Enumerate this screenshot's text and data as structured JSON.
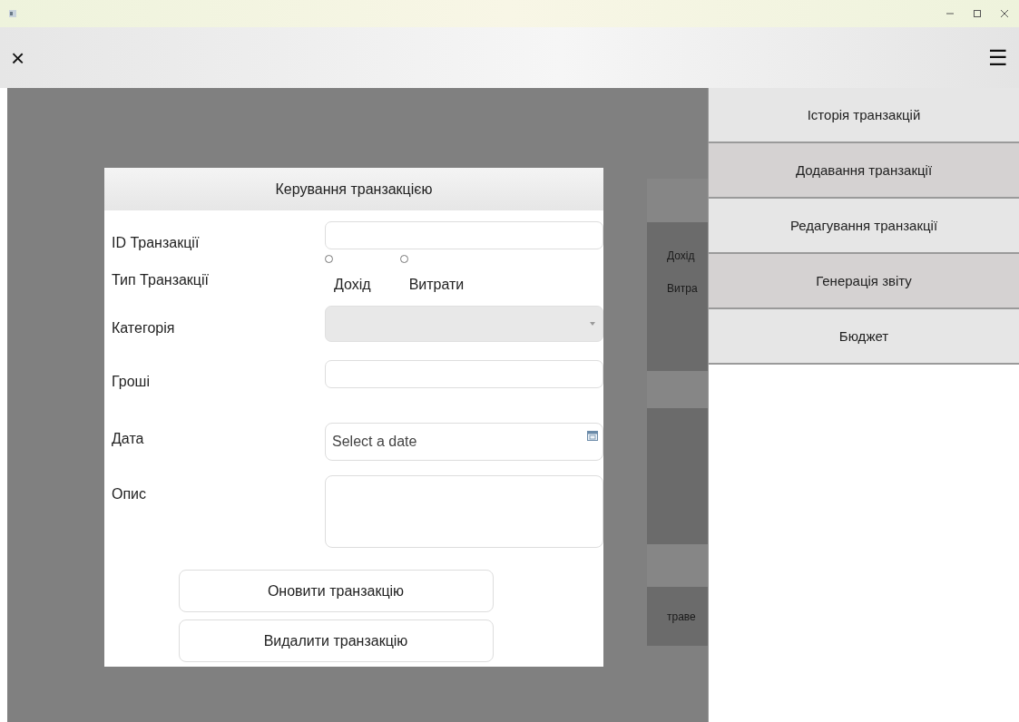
{
  "header": {
    "close_icon": "×",
    "menu_icon": "☰"
  },
  "background": {
    "cards": [
      {
        "kind": "panel",
        "lines": [
          "Дохід",
          "Витра"
        ]
      },
      {
        "kind": "panel"
      },
      {
        "kind": "panel",
        "lines": [
          "траве"
        ]
      }
    ]
  },
  "dialog": {
    "title": "Керування транзакцією",
    "id_label": "ID Транзакції",
    "type_label": "Тип Транзакції",
    "type_options": [
      {
        "label": "Дохід",
        "selected": false
      },
      {
        "label": "Витрати",
        "selected": false
      }
    ],
    "category_label": "Категорія",
    "category_disabled": true,
    "money_label": "Гроші",
    "date_label": "Дата",
    "date_placeholder": "Select a date",
    "description_label": "Опис",
    "buttons": [
      "Оновити транзакцію",
      "Видалити транзакцію"
    ]
  },
  "menu": {
    "items": [
      "Історія транзакцій",
      "Додавання транзакції",
      "Редагування транзакції",
      "Генерація звіту",
      "Бюджет"
    ]
  }
}
